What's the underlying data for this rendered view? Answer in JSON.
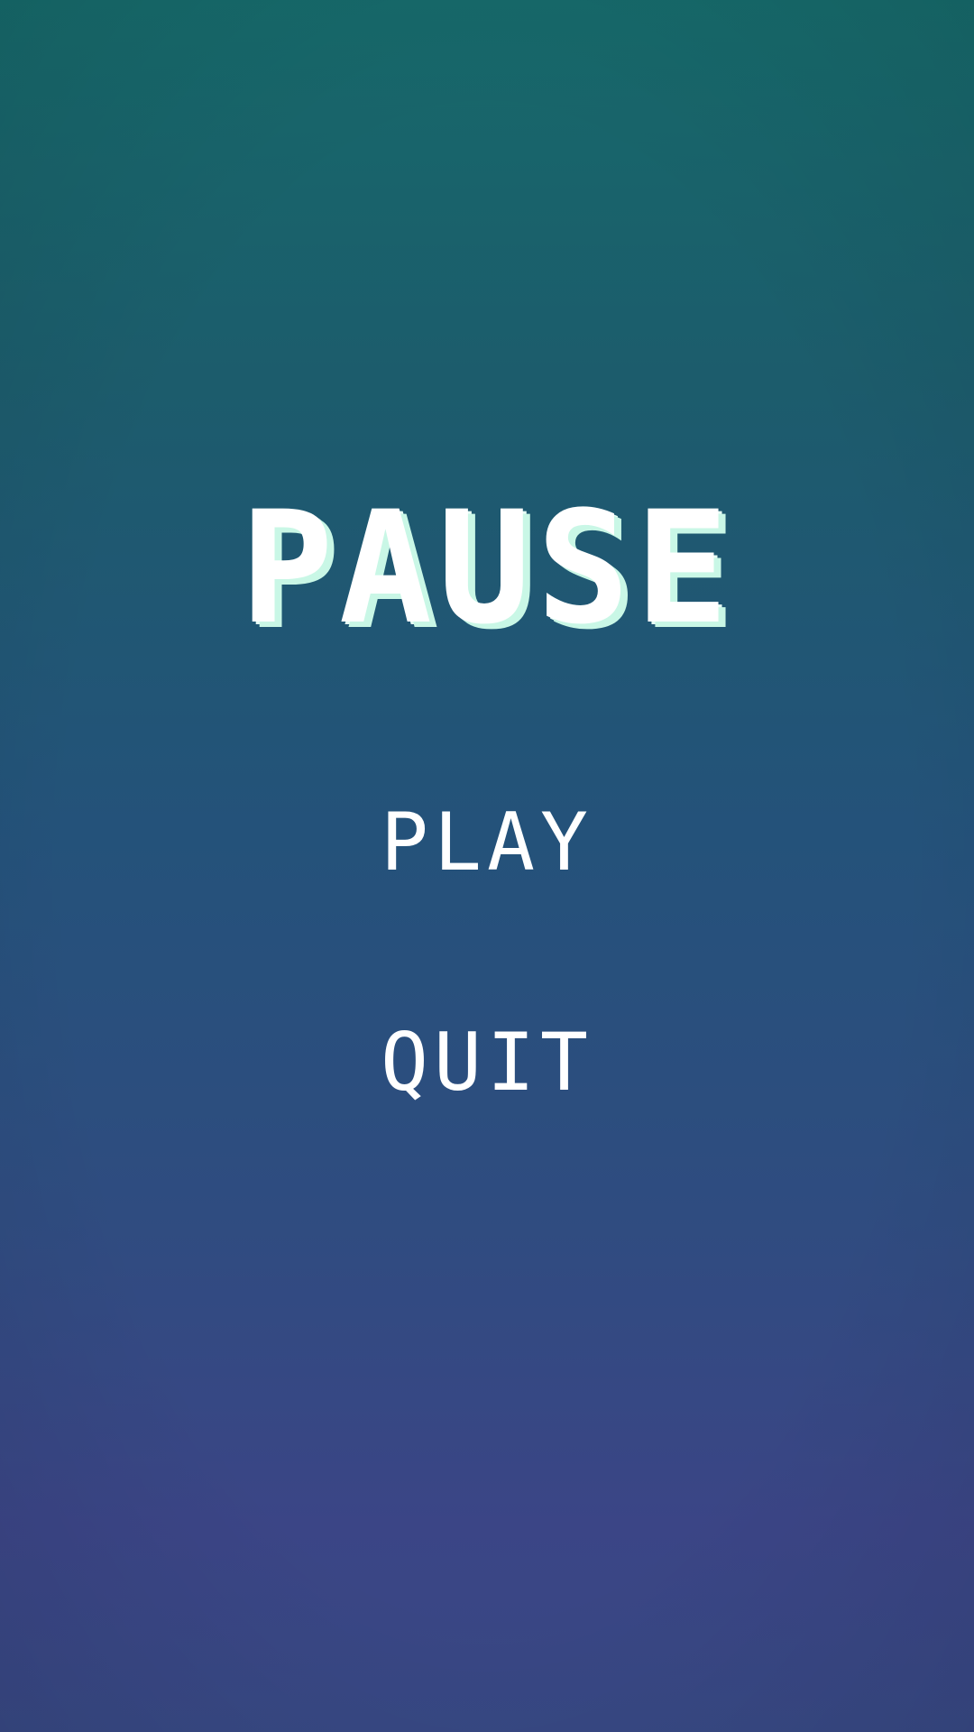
{
  "pause_menu": {
    "title": "PAUSE",
    "items": [
      {
        "label": "PLAY"
      },
      {
        "label": "QUIT"
      }
    ]
  },
  "colors": {
    "background_top": "#16696a",
    "background_bottom": "#3b4586",
    "grid_line": "#6f8f95",
    "title_text": "#ffffff",
    "title_shadow": "#c9f7e6",
    "menu_text": "#ffffff"
  }
}
